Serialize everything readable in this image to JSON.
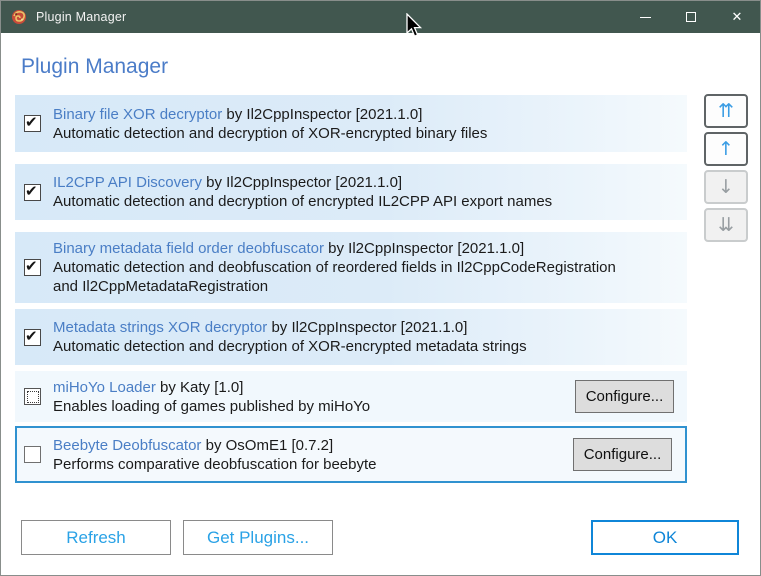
{
  "window": {
    "title": "Plugin Manager",
    "icon": "plugin-manager-app-icon"
  },
  "titlebar_controls": {
    "minimize": "minimize",
    "maximize": "maximize",
    "close": "✕"
  },
  "heading": "Plugin Manager",
  "plugins": [
    {
      "name": "Binary file XOR decryptor",
      "byline": "by Il2CppInspector [2021.1.0]",
      "description": "Automatic detection and decryption of XOR-encrypted binary files",
      "checked": "checked"
    },
    {
      "name": "IL2CPP API Discovery",
      "byline": "by Il2CppInspector [2021.1.0]",
      "description": "Automatic detection and decryption of encrypted IL2CPP API export names",
      "checked": "checked"
    },
    {
      "name": "Binary metadata field order deobfuscator",
      "byline": "by Il2CppInspector [2021.1.0]",
      "description": "Automatic detection and deobfuscation of reordered fields in Il2CppCodeRegistration and Il2CppMetadataRegistration",
      "checked": "checked"
    },
    {
      "name": "Metadata strings XOR decryptor",
      "byline": "by Il2CppInspector [2021.1.0]",
      "description": "Automatic detection and decryption of XOR-encrypted metadata strings",
      "checked": "checked"
    },
    {
      "name": "miHoYo Loader",
      "byline": "by Katy [1.0]",
      "description": "Enables loading of games published by miHoYo",
      "checked": "indeterminate",
      "configure_label": "Configure..."
    },
    {
      "name": "Beebyte Deobfuscator",
      "byline": "by OsOmE1 [0.7.2]",
      "description": "Performs comparative deobfuscation for beebyte",
      "checked": "unchecked",
      "selected": true,
      "configure_label": "Configure..."
    }
  ],
  "reorder": [
    {
      "name": "move-to-top",
      "glyph": "⇈",
      "enabled": true
    },
    {
      "name": "move-up",
      "glyph": "↑",
      "enabled": true
    },
    {
      "name": "move-down",
      "glyph": "↓",
      "enabled": false
    },
    {
      "name": "move-to-bottom",
      "glyph": "⇊",
      "enabled": false
    }
  ],
  "footer": {
    "refresh": "Refresh",
    "get_plugins": "Get Plugins...",
    "ok": "OK"
  },
  "colors": {
    "titlebar_bg": "#41574f",
    "heading_text": "#4b7cc8",
    "plugin_link": "#4a7ec5",
    "row_bg": "#dcebf8",
    "selected_row_border": "#3092d0",
    "footer_link_text": "#2aa2e6",
    "ok_accent": "#0f86d8",
    "configure_bg": "#dddddd"
  }
}
